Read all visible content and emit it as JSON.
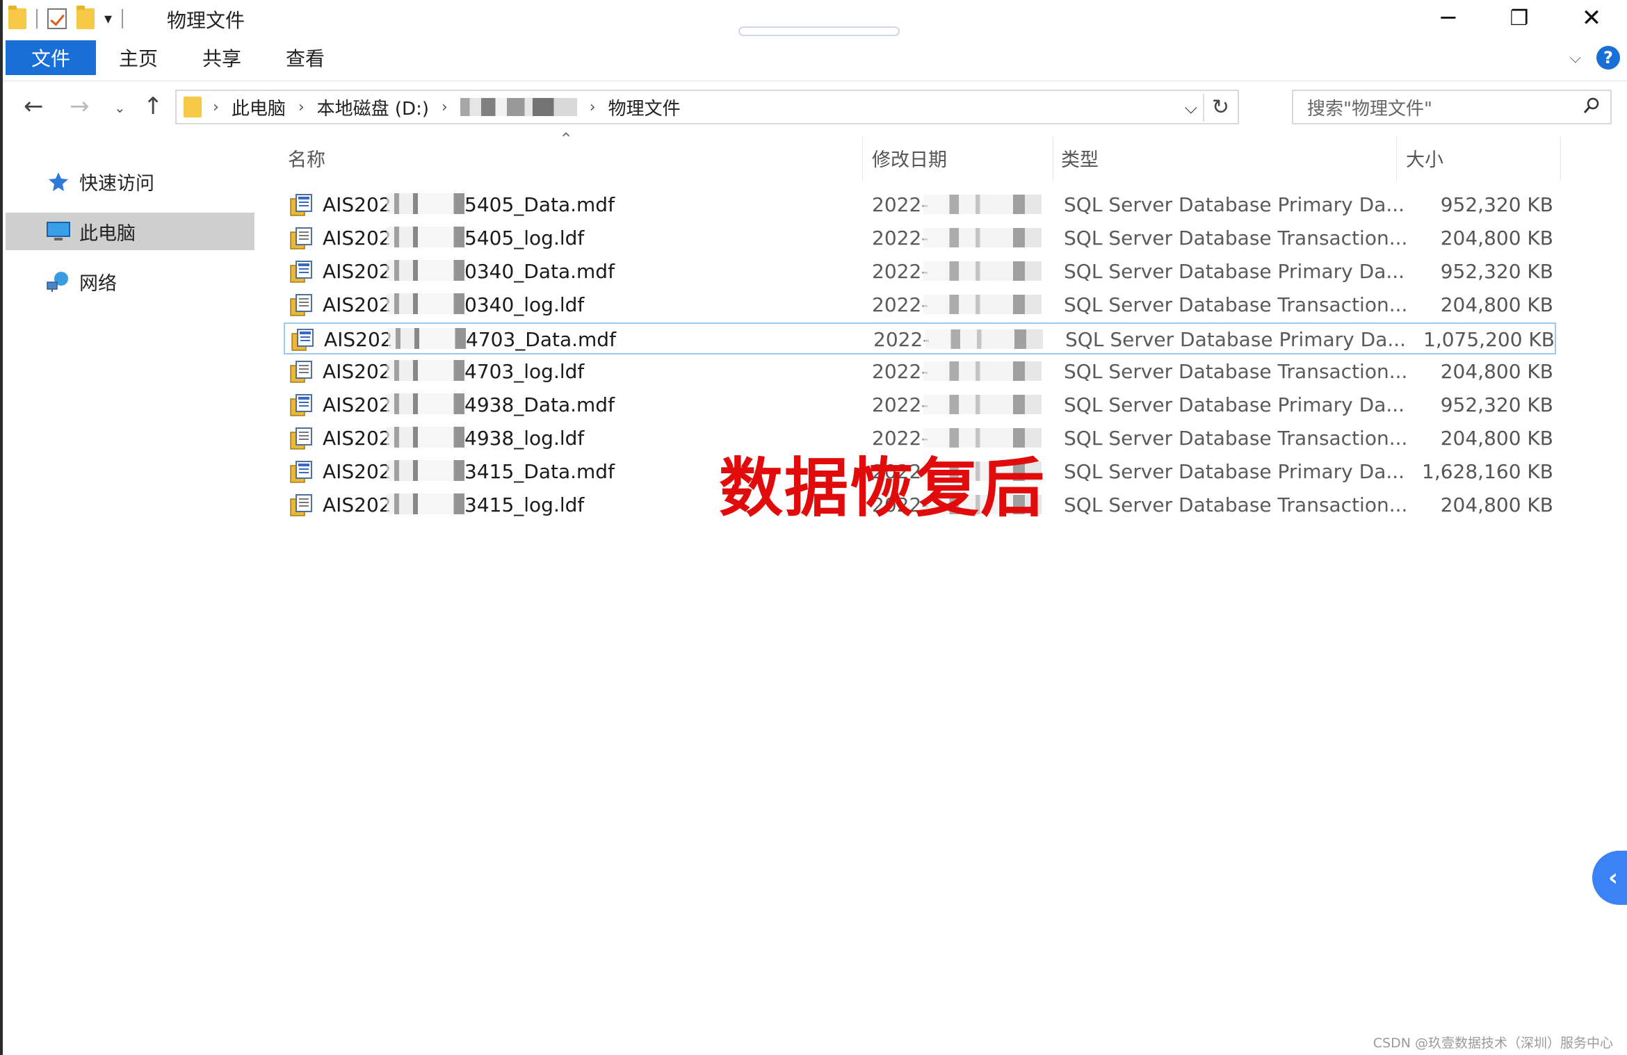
{
  "window": {
    "title": "物理文件",
    "minimize": "─",
    "restore": "❐",
    "close": "✕"
  },
  "qat": {
    "dropdown": "▾"
  },
  "ribbon": {
    "tabs": [
      "文件",
      "主页",
      "共享",
      "查看"
    ],
    "expand": "⌵",
    "help": "?"
  },
  "nav": {
    "back": "←",
    "forward": "→",
    "recent": "⌄",
    "up": "↑"
  },
  "address": {
    "crumbs": [
      "此电脑",
      "本地磁盘 (D:)",
      "",
      "物理文件"
    ],
    "separator": "›",
    "dropdown": "⌵",
    "refresh": "↻"
  },
  "search": {
    "placeholder": "搜索\"物理文件\""
  },
  "navpane": {
    "items": [
      {
        "label": "快速访问",
        "icon": "star-pin-icon"
      },
      {
        "label": "此电脑",
        "icon": "monitor-icon",
        "selected": true
      },
      {
        "label": "网络",
        "icon": "network-icon"
      }
    ]
  },
  "list": {
    "collapse": "⌃",
    "columns": {
      "name": "名称",
      "date": "修改日期",
      "type": "类型",
      "size": "大小"
    },
    "rows": [
      {
        "prefix": "AIS202",
        "suffix": "5405_Data.mdf",
        "date": "2022-",
        "type": "SQL Server Database Primary Da...",
        "size": "952,320 KB",
        "kind": "mdf"
      },
      {
        "prefix": "AIS202",
        "suffix": "5405_log.ldf",
        "date": "2022-",
        "type": "SQL Server Database Transaction...",
        "size": "204,800 KB",
        "kind": "ldf"
      },
      {
        "prefix": "AIS202",
        "suffix": "0340_Data.mdf",
        "date": "2022-",
        "type": "SQL Server Database Primary Da...",
        "size": "952,320 KB",
        "kind": "mdf"
      },
      {
        "prefix": "AIS202",
        "suffix": "0340_log.ldf",
        "date": "2022-",
        "type": "SQL Server Database Transaction...",
        "size": "204,800 KB",
        "kind": "ldf"
      },
      {
        "prefix": "AIS202",
        "suffix": "4703_Data.mdf",
        "date": "2022-",
        "type": "SQL Server Database Primary Da...",
        "size": "1,075,200 KB",
        "kind": "mdf",
        "selected": true
      },
      {
        "prefix": "AIS202",
        "suffix": "4703_log.ldf",
        "date": "2022-",
        "type": "SQL Server Database Transaction...",
        "size": "204,800 KB",
        "kind": "ldf"
      },
      {
        "prefix": "AIS202",
        "suffix": "4938_Data.mdf",
        "date": "2022-",
        "type": "SQL Server Database Primary Da...",
        "size": "952,320 KB",
        "kind": "mdf"
      },
      {
        "prefix": "AIS202",
        "suffix": "4938_log.ldf",
        "date": "2022-",
        "type": "SQL Server Database Transaction...",
        "size": "204,800 KB",
        "kind": "ldf"
      },
      {
        "prefix": "AIS202",
        "suffix": "3415_Data.mdf",
        "date": "2022-",
        "type": "SQL Server Database Primary Da...",
        "size": "1,628,160 KB",
        "kind": "mdf"
      },
      {
        "prefix": "AIS202",
        "suffix": "3415_log.ldf",
        "date": "2022-",
        "type": "SQL Server Database Transaction...",
        "size": "204,800 KB",
        "kind": "ldf"
      }
    ]
  },
  "overlay": "数据恢复后",
  "side_tab": "‹",
  "watermark": "CSDN @玖壹数据技术（深圳）服务中心",
  "colors": {
    "accent": "#1a6fd6",
    "folder": "#f5c945",
    "overlay": "#e10b0b",
    "selection": "#99c9ef"
  }
}
